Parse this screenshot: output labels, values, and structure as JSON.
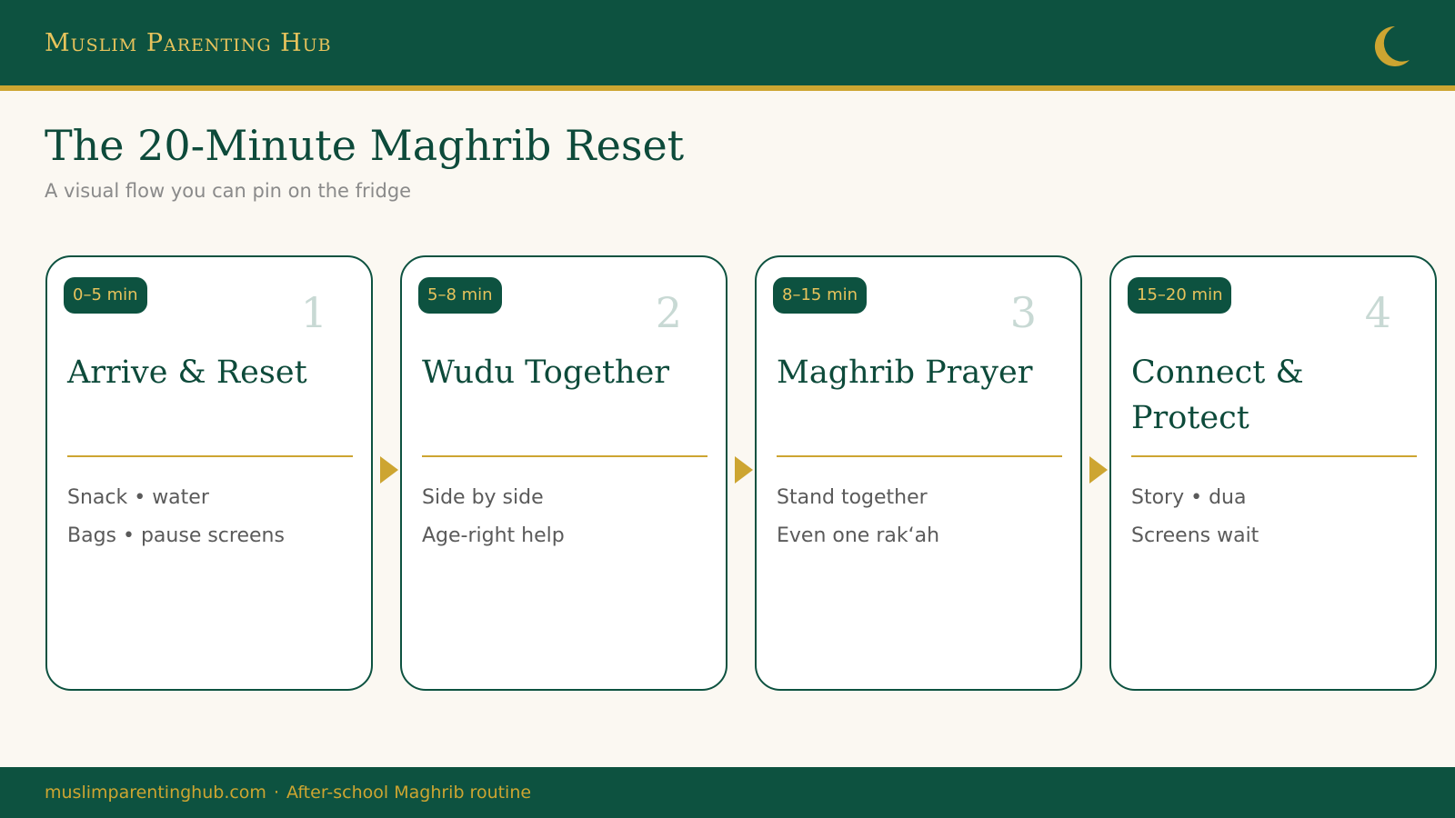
{
  "header": {
    "brand": "Muslim Parenting Hub",
    "icon": "crescent-moon-icon",
    "colors": {
      "background": "#0d5240",
      "accent": "#cda531"
    }
  },
  "page": {
    "title": "The 20-Minute Maghrib Reset",
    "subtitle": "A visual flow you can pin on the fridge"
  },
  "steps": [
    {
      "time": "0–5 min",
      "number": "1",
      "title": "Arrive & Reset",
      "details": [
        "Snack • water",
        "Bags • pause screens"
      ]
    },
    {
      "time": "5–8 min",
      "number": "2",
      "title": "Wudu Together",
      "details": [
        "Side by side",
        "Age-right help"
      ]
    },
    {
      "time": "8–15 min",
      "number": "3",
      "title": "Maghrib Prayer",
      "details": [
        "Stand together",
        "Even one rak‘ah"
      ]
    },
    {
      "time": "15–20 min",
      "number": "4",
      "title": "Connect & Protect",
      "details": [
        "Story • dua",
        "Screens wait"
      ]
    }
  ],
  "connector_icon": "arrow-right-icon",
  "footer": {
    "site": "muslimparentinghub.com",
    "separator": "·",
    "caption": "After-school Maghrib routine"
  }
}
